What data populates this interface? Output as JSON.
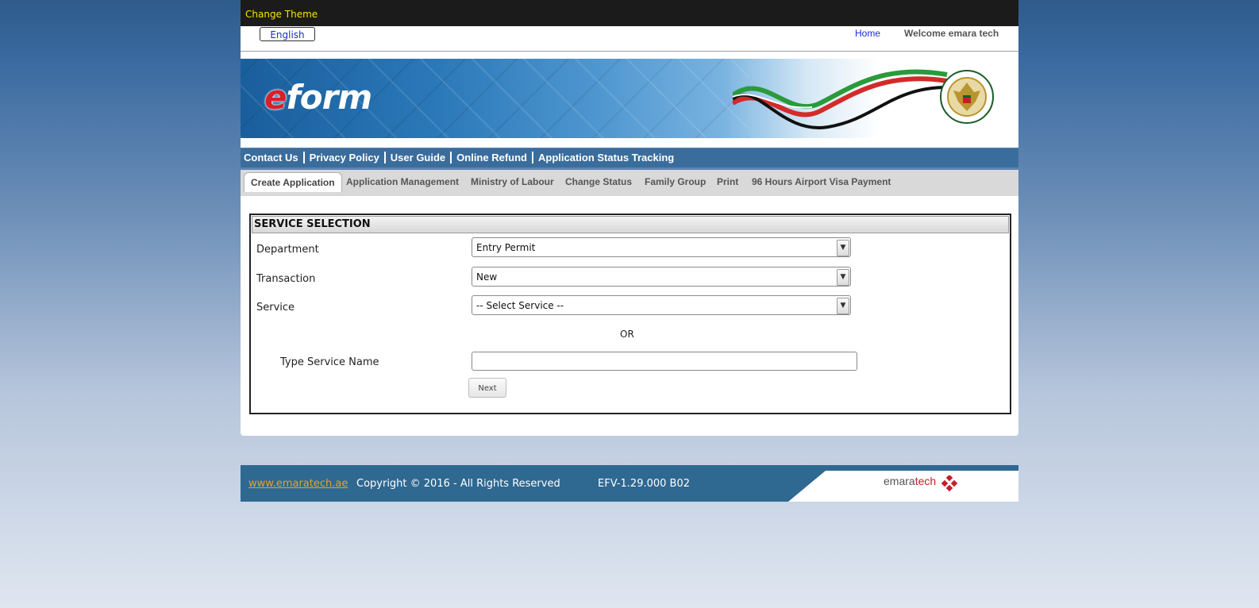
{
  "theme": {
    "change_theme_label": "Change Theme"
  },
  "header": {
    "language_label": "English",
    "home_label": "Home",
    "welcome_text": "Welcome emara tech"
  },
  "banner": {
    "logo_e": "e",
    "logo_rest": "form"
  },
  "nav": {
    "items": [
      "Contact Us",
      "Privacy Policy",
      "User Guide",
      "Online Refund",
      "Application Status Tracking"
    ]
  },
  "tabs": {
    "items": [
      "Create Application",
      "Application Management",
      "Ministry of Labour",
      "Change Status",
      "Family Group",
      "Print",
      "96 Hours Airport Visa Payment"
    ],
    "active": "Create Application"
  },
  "service_selection": {
    "title": "SERVICE SELECTION",
    "department_label": "Department",
    "department_value": "Entry Permit",
    "transaction_label": "Transaction",
    "transaction_value": "New",
    "service_label": "Service",
    "service_value": "-- Select Service --",
    "or_text": "OR",
    "type_service_label": "Type Service Name",
    "type_service_value": "",
    "next_label": "Next"
  },
  "footer": {
    "link_text": "www.emaratech.ae",
    "copyright": "Copyright © 2016 - All Rights Reserved",
    "version": "EFV-1.29.000 B02",
    "brand_main": "emara",
    "brand_accent": "tech"
  },
  "colors": {
    "theme_link": "#f5e400",
    "nav_bar": "#3a6d9c",
    "footer_bar": "#2f6890",
    "footer_link": "#f0a020",
    "link_blue": "#1a2bd6"
  },
  "icons": [
    "dropdown-arrow-icon",
    "emirates-emblem-icon",
    "emaratech-diamond-icon"
  ]
}
